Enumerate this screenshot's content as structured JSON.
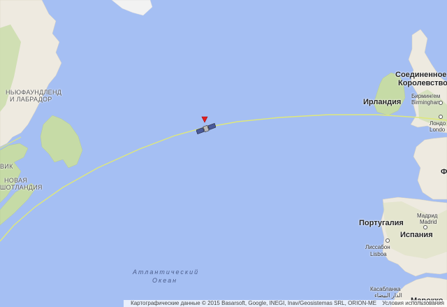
{
  "map": {
    "labels": {
      "nf": "НЬЮФАУНДЛЕНД",
      "lab": "И ЛАБРАДОР",
      "ns1": "ВИК",
      "ns2": "НОВАЯ",
      "ns3": "ШОТЛАНДИЯ",
      "uk1": "Соединенное",
      "uk2": "Королевство",
      "ireland": "Ирландия",
      "birm1": "Бирмингем",
      "birm2": "Birmingham",
      "london1": "Лондо",
      "london2": "Londo",
      "portugal": "Португалия",
      "spain": "Испания",
      "madrid1": "Мадрид",
      "madrid2": "Madrid",
      "lisbon1": "Лиссабон",
      "lisbon2": "Lisboa",
      "casa1": "Касабланка",
      "casa2": "الدار البيضاء",
      "morocco": "Марокко",
      "ocean1": "Атлантический",
      "ocean2": "Океан",
      "fr": "Ф"
    },
    "attribution": "Картографические данные © 2015 Basarsoft, Google, INEGI, Inav/Geosistemas SRL, ORION-ME",
    "terms": "Условия использования",
    "colors": {
      "water": "#a5bff3",
      "land": "#eeeae0",
      "green": "#c6dba6",
      "track": "#dfe87a"
    },
    "icons": {
      "satellite": "satellite-icon",
      "marker": "red-marker-icon"
    }
  }
}
